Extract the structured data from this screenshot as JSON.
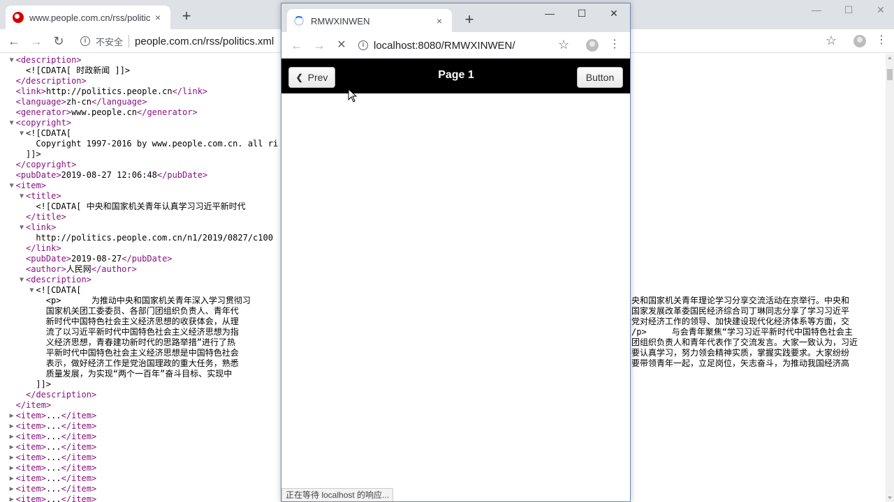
{
  "back_browser": {
    "tab_title": "www.people.com.cn/rss/politic",
    "tab_close": "×",
    "new_tab": "+",
    "not_secure": "不安全",
    "url": "people.com.cn/rss/politics.xml",
    "window_controls": {
      "minimize": "—",
      "maximize": "☐",
      "close": "✕"
    }
  },
  "xml_lines": [
    {
      "indent": 3,
      "toggle": "▼",
      "parts": [
        [
          "tag",
          "<description>"
        ]
      ]
    },
    {
      "indent": 5,
      "toggle": "",
      "parts": [
        [
          "text",
          "<![CDATA[ 时政新闻 ]]>"
        ]
      ]
    },
    {
      "indent": 3,
      "toggle": "",
      "parts": [
        [
          "tag",
          "</description>"
        ]
      ]
    },
    {
      "indent": 3,
      "toggle": "",
      "parts": [
        [
          "tag",
          "<link>"
        ],
        [
          "text",
          "http://politics.people.cn"
        ],
        [
          "tag",
          "</link>"
        ]
      ]
    },
    {
      "indent": 3,
      "toggle": "",
      "parts": [
        [
          "tag",
          "<language>"
        ],
        [
          "text",
          "zh-cn"
        ],
        [
          "tag",
          "</language>"
        ]
      ]
    },
    {
      "indent": 3,
      "toggle": "",
      "parts": [
        [
          "tag",
          "<generator>"
        ],
        [
          "text",
          "www.people.cn"
        ],
        [
          "tag",
          "</generator>"
        ]
      ]
    },
    {
      "indent": 3,
      "toggle": "▼",
      "parts": [
        [
          "tag",
          "<copyright>"
        ]
      ]
    },
    {
      "indent": 5,
      "toggle": "▼",
      "parts": [
        [
          "text",
          "<![CDATA["
        ]
      ]
    },
    {
      "indent": 7,
      "toggle": "",
      "parts": [
        [
          "text",
          "Copyright 1997-2016 by www.people.com.cn. all ri"
        ]
      ]
    },
    {
      "indent": 5,
      "toggle": "",
      "parts": [
        [
          "text",
          "]]>"
        ]
      ]
    },
    {
      "indent": 3,
      "toggle": "",
      "parts": [
        [
          "tag",
          "</copyright>"
        ]
      ]
    },
    {
      "indent": 3,
      "toggle": "",
      "parts": [
        [
          "tag",
          "<pubDate>"
        ],
        [
          "text",
          "2019-08-27 12:06:48"
        ],
        [
          "tag",
          "</pubDate>"
        ]
      ]
    },
    {
      "indent": 3,
      "toggle": "▼",
      "parts": [
        [
          "tag",
          "<item>"
        ]
      ]
    },
    {
      "indent": 5,
      "toggle": "▼",
      "parts": [
        [
          "tag",
          "<title>"
        ]
      ]
    },
    {
      "indent": 7,
      "toggle": "",
      "parts": [
        [
          "text",
          "<![CDATA[ 中央和国家机关青年认真学习习近平新时代"
        ]
      ]
    },
    {
      "indent": 5,
      "toggle": "",
      "parts": [
        [
          "tag",
          "</title>"
        ]
      ]
    },
    {
      "indent": 5,
      "toggle": "▼",
      "parts": [
        [
          "tag",
          "<link>"
        ]
      ]
    },
    {
      "indent": 7,
      "toggle": "",
      "parts": [
        [
          "text",
          "http://politics.people.com.cn/n1/2019/0827/c100"
        ]
      ]
    },
    {
      "indent": 5,
      "toggle": "",
      "parts": [
        [
          "tag",
          "</link>"
        ]
      ]
    },
    {
      "indent": 5,
      "toggle": "",
      "parts": [
        [
          "tag",
          "<pubDate>"
        ],
        [
          "text",
          "2019-08-27"
        ],
        [
          "tag",
          "</pubDate>"
        ]
      ]
    },
    {
      "indent": 5,
      "toggle": "",
      "parts": [
        [
          "tag",
          "<author>"
        ],
        [
          "text",
          "人民网"
        ],
        [
          "tag",
          "</author>"
        ]
      ]
    },
    {
      "indent": 5,
      "toggle": "▼",
      "parts": [
        [
          "tag",
          "<description>"
        ]
      ]
    },
    {
      "indent": 7,
      "toggle": "▼",
      "parts": [
        [
          "text",
          "<![CDATA["
        ]
      ]
    },
    {
      "indent": 9,
      "toggle": "",
      "parts": [
        [
          "text",
          "<p>      为推动中央和国家机关青年深入学习贯彻习"
        ]
      ]
    },
    {
      "indent": 9,
      "toggle": "",
      "parts": [
        [
          "text",
          "国家机关团工委委员、各部门团组织负责人、青年代"
        ]
      ]
    },
    {
      "indent": 9,
      "toggle": "",
      "parts": [
        [
          "text",
          "新时代中国特色社会主义经济思想的收获体会，从理"
        ]
      ]
    },
    {
      "indent": 9,
      "toggle": "",
      "parts": [
        [
          "text",
          "流了以习近平新时代中国特色社会主义经济思想为指"
        ]
      ]
    },
    {
      "indent": 9,
      "toggle": "",
      "parts": [
        [
          "text",
          "义经济思想，青春建功新时代的思路举措”进行了热"
        ]
      ]
    },
    {
      "indent": 9,
      "toggle": "",
      "parts": [
        [
          "text",
          "平新时代中国特色社会主义经济思想是中国特色社会"
        ]
      ]
    },
    {
      "indent": 9,
      "toggle": "",
      "parts": [
        [
          "text",
          "表示，做好经济工作是党治国理政的重大任务，熟悉"
        ]
      ]
    },
    {
      "indent": 9,
      "toggle": "",
      "parts": [
        [
          "text",
          "质量发展，为实现“两个一百年”奋斗目标、实现中"
        ]
      ]
    },
    {
      "indent": 7,
      "toggle": "",
      "parts": [
        [
          "text",
          "]]>"
        ]
      ]
    },
    {
      "indent": 5,
      "toggle": "",
      "parts": [
        [
          "tag",
          "</description>"
        ]
      ]
    },
    {
      "indent": 3,
      "toggle": "",
      "parts": [
        [
          "tag",
          "</item>"
        ]
      ]
    },
    {
      "indent": 3,
      "toggle": "▶",
      "parts": [
        [
          "tag",
          "<item>"
        ],
        [
          "text",
          "..."
        ],
        [
          "tag",
          "</item>"
        ]
      ]
    },
    {
      "indent": 3,
      "toggle": "▶",
      "parts": [
        [
          "tag",
          "<item>"
        ],
        [
          "text",
          "..."
        ],
        [
          "tag",
          "</item>"
        ]
      ]
    },
    {
      "indent": 3,
      "toggle": "▶",
      "parts": [
        [
          "tag",
          "<item>"
        ],
        [
          "text",
          "..."
        ],
        [
          "tag",
          "</item>"
        ]
      ]
    },
    {
      "indent": 3,
      "toggle": "▶",
      "parts": [
        [
          "tag",
          "<item>"
        ],
        [
          "text",
          "..."
        ],
        [
          "tag",
          "</item>"
        ]
      ]
    },
    {
      "indent": 3,
      "toggle": "▶",
      "parts": [
        [
          "tag",
          "<item>"
        ],
        [
          "text",
          "..."
        ],
        [
          "tag",
          "</item>"
        ]
      ]
    },
    {
      "indent": 3,
      "toggle": "▶",
      "parts": [
        [
          "tag",
          "<item>"
        ],
        [
          "text",
          "..."
        ],
        [
          "tag",
          "</item>"
        ]
      ]
    },
    {
      "indent": 3,
      "toggle": "▶",
      "parts": [
        [
          "tag",
          "<item>"
        ],
        [
          "text",
          "..."
        ],
        [
          "tag",
          "</item>"
        ]
      ]
    },
    {
      "indent": 3,
      "toggle": "▶",
      "parts": [
        [
          "tag",
          "<item>"
        ],
        [
          "text",
          "..."
        ],
        [
          "tag",
          "</item>"
        ]
      ]
    },
    {
      "indent": 3,
      "toggle": "▶",
      "parts": [
        [
          "tag",
          "<item>"
        ],
        [
          "text",
          "..."
        ],
        [
          "tag",
          "</item>"
        ]
      ]
    }
  ],
  "xml_right_fragments": [
    {
      "line": 23,
      "text": "央和国家机关青年理论学习分享交流活动在京举行。中央和"
    },
    {
      "line": 24,
      "text": "国家发展改革委国民经济综合司丁琳同志分享了学习习近平"
    },
    {
      "line": 25,
      "text": "党对经济工作的领导、加快建设现代化经济体系等方面，交"
    },
    {
      "line": 26,
      "text": "/p>     与会青年聚焦“学习习近平新时代中国特色社会主"
    },
    {
      "line": 27,
      "text": "团组织负责人和青年代表作了交流发言。大家一致认为，习近"
    },
    {
      "line": 28,
      "text": "要认真学习，努力领会精神实质，掌握实践要求。大家纷纷"
    },
    {
      "line": 29,
      "text": "要带领青年一起，立足岗位，矢志奋斗，为推动我国经济高"
    }
  ],
  "front_browser": {
    "tab_title": "RMWXINWEN",
    "tab_close": "×",
    "new_tab": "+",
    "url": "localhost:8080/RMWXINWEN/",
    "window_controls": {
      "minimize": "—",
      "maximize": "☐",
      "close": "✕"
    },
    "status_text": "正在等待 localhost 的响应..."
  },
  "app": {
    "prev_label": "Prev",
    "title": "Page 1",
    "button_label": "Button"
  },
  "colors": {
    "xml_tag": "#881280",
    "app_header_bg": "#000000",
    "spinner_accent": "#1a73e8"
  }
}
